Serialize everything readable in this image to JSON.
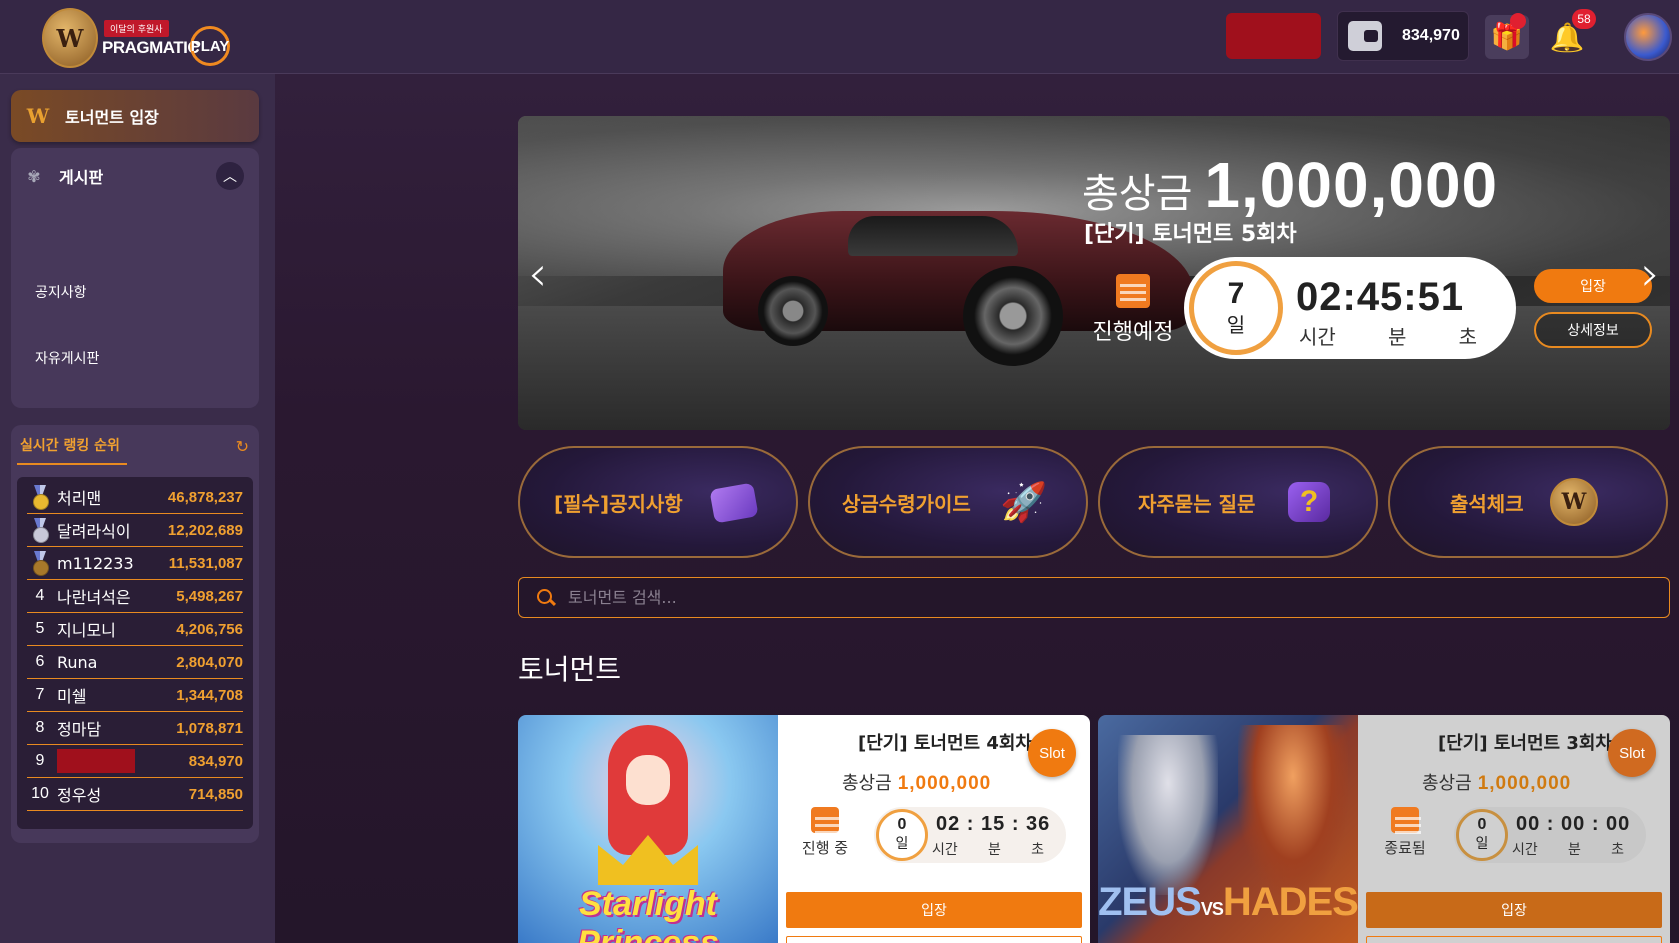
{
  "header": {
    "logo": {
      "sponsor_tag": "이달의 후원사",
      "brand_text": "PRAGMATIC",
      "brand_play": "PLAY"
    },
    "wallet_amount": "834,970",
    "notification_count": "58"
  },
  "sidebar": {
    "enter_tournament": "토너먼트 입장",
    "board": {
      "label": "게시판",
      "items": [
        "공지사항",
        "자유게시판"
      ]
    },
    "ranking": {
      "title": "실시간 랭킹 순위",
      "rows": [
        {
          "rank": "1",
          "name": "처리맨",
          "score": "46,878,237",
          "medal": "gold"
        },
        {
          "rank": "2",
          "name": "달려라식이",
          "score": "12,202,689",
          "medal": "silver"
        },
        {
          "rank": "3",
          "name": "m112233",
          "score": "11,531,087",
          "medal": "bronze"
        },
        {
          "rank": "4",
          "name": "나란녀석은",
          "score": "5,498,267"
        },
        {
          "rank": "5",
          "name": "지니모니",
          "score": "4,206,756"
        },
        {
          "rank": "6",
          "name": "Runa",
          "score": "2,804,070"
        },
        {
          "rank": "7",
          "name": "미쉘",
          "score": "1,344,708"
        },
        {
          "rank": "8",
          "name": "정마담",
          "score": "1,078,871"
        },
        {
          "rank": "9",
          "name": "",
          "score": "834,970",
          "hidden": true
        },
        {
          "rank": "10",
          "name": "정우성",
          "score": "714,850"
        }
      ]
    }
  },
  "banner": {
    "prize_label": "총상금",
    "prize_value": "1,000,000",
    "name": "[단기] 토너먼트 5회차",
    "status": "진행예정",
    "days": "7",
    "day_unit": "일",
    "clock": "02:45:51",
    "units": [
      "시간",
      "분",
      "초"
    ],
    "enter_label": "입장",
    "detail_label": "상세정보"
  },
  "quick_links": [
    {
      "label": "[필수]공지사항",
      "icon": "envelope-icon"
    },
    {
      "label": "상금수령가이드",
      "icon": "rocket-icon"
    },
    {
      "label": "자주묻는 질문",
      "icon": "faq-icon"
    },
    {
      "label": "출석체크",
      "icon": "crest-icon"
    }
  ],
  "search": {
    "placeholder": "토너먼트 검색..."
  },
  "section_title": "토너먼트",
  "tournaments": [
    {
      "game_title": "Starlight Princess",
      "title": "[단기] 토너먼트 4회차",
      "badge": "Slot",
      "prize_label": "총상금",
      "prize_value": "1,000,000",
      "status": "진행 중",
      "days": "0",
      "day_unit": "일",
      "clock": "02 : 15 : 36",
      "units": [
        "시간",
        "분",
        "초"
      ],
      "enter_label": "입장"
    },
    {
      "game_title_left": "ZEUS",
      "game_title_vs": "VS",
      "game_title_right": "HADES",
      "title": "[단기] 토너먼트 3회차",
      "badge": "Slot",
      "prize_label": "총상금",
      "prize_value": "1,000,000",
      "status": "종료됨",
      "days": "0",
      "day_unit": "일",
      "clock": "00 : 00 : 00",
      "units": [
        "시간",
        "분",
        "초"
      ],
      "enter_label": "입장"
    }
  ],
  "colors": {
    "accent": "#f07a10",
    "gold_text": "#f0a030",
    "hidden_red": "#a0101c"
  }
}
